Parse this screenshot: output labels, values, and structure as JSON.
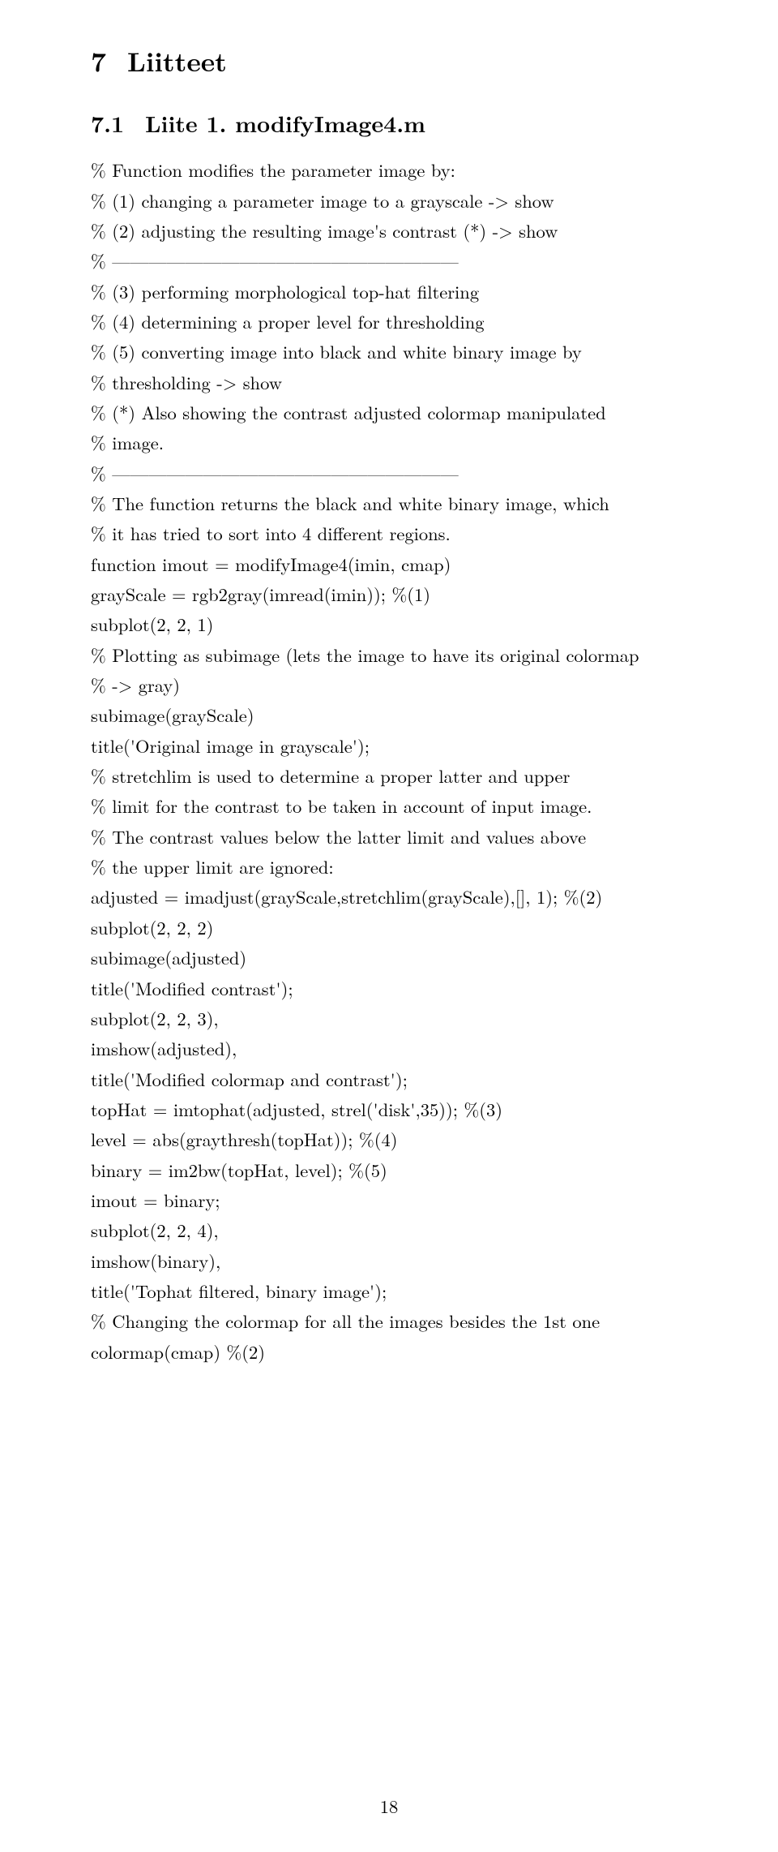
{
  "heading": {
    "num": "7",
    "title": "Liitteet"
  },
  "subheading": {
    "num": "7.1",
    "title": "Liite 1. modifyImage4.m"
  },
  "lines": [
    "% Function modifies the parameter image by:",
    "% (1) changing a parameter image to a grayscale -> show",
    "% (2) adjusting the resulting image's contrast (*) -> show",
    "% ———————————————————",
    "% (3) performing morphological top-hat filtering",
    "% (4) determining a proper level for thresholding",
    "% (5) converting image into black and white binary image by",
    "% thresholding -> show",
    "% (*) Also showing the contrast adjusted colormap manipulated",
    "% image.",
    "% ———————————————————",
    "% The function returns the black and white binary image, which",
    "% it has tried to sort into 4 different regions.",
    "function imout = modifyImage4(imin, cmap)",
    "grayScale = rgb2gray(imread(imin)); %(1)",
    "subplot(2, 2, 1)",
    "% Plotting as subimage (lets the image to have its original colormap",
    "% -> gray)",
    "subimage(grayScale)",
    "title('Original image in grayscale');",
    "% stretchlim is used to determine a proper latter and upper",
    "% limit for the contrast to be taken in account of input image.",
    "% The contrast values below the latter limit and values above",
    "% the upper limit are ignored:",
    "adjusted = imadjust(grayScale,stretchlim(grayScale),[], 1); %(2)",
    "subplot(2, 2, 2)",
    "subimage(adjusted)",
    "title('Modified contrast');",
    "subplot(2, 2, 3),",
    "imshow(adjusted),",
    "title('Modified colormap and contrast');",
    "topHat = imtophat(adjusted, strel('disk',35)); %(3)",
    "level = abs(graythresh(topHat)); %(4)",
    "binary = im2bw(topHat, level); %(5)",
    "imout = binary;",
    "subplot(2, 2, 4),",
    "imshow(binary),",
    "title('Tophat filtered, binary image');",
    "% Changing the colormap for all the images besides the 1st one",
    "colormap(cmap) %(2)"
  ],
  "page_number": "18"
}
